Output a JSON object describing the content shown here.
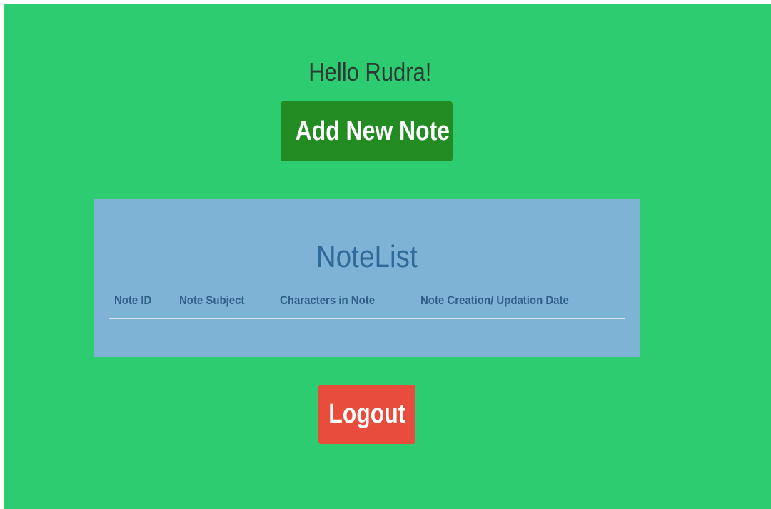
{
  "greeting": "Hello Rudra!",
  "add_button_label": "Add New Note",
  "note_list": {
    "title": "NoteList",
    "columns": [
      "Note ID",
      "Note Subject",
      "Characters in Note",
      "Note Creation/ Updation Date"
    ],
    "rows": []
  },
  "logout_button_label": "Logout",
  "colors": {
    "background": "#2ecc71",
    "add_button": "#228b22",
    "panel": "#7fb3d5",
    "panel_text": "#2e6a9a",
    "logout_button": "#e74c3c"
  }
}
